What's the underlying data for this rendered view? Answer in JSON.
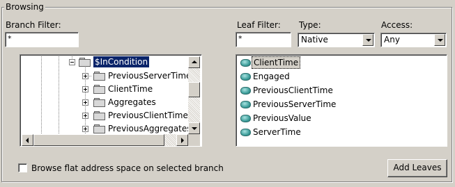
{
  "group": {
    "title": "Browsing"
  },
  "branch_filter": {
    "label": "Branch Filter:",
    "value": "*"
  },
  "leaf_filter": {
    "label": "Leaf Filter:",
    "value": "*"
  },
  "type": {
    "label": "Type:",
    "selected": "Native"
  },
  "access": {
    "label": "Access:",
    "selected": "Any"
  },
  "tree": {
    "items": [
      {
        "label": "$InCondition",
        "expanded": true,
        "selected": true
      },
      {
        "label": "PreviousServerTime"
      },
      {
        "label": "ClientTime"
      },
      {
        "label": "Aggregates"
      },
      {
        "label": "PreviousClientTime"
      },
      {
        "label": "PreviousAggregates"
      }
    ]
  },
  "leaves": {
    "items": [
      {
        "label": "ClientTime",
        "selected": true
      },
      {
        "label": "Engaged"
      },
      {
        "label": "PreviousClientTime"
      },
      {
        "label": "PreviousServerTime"
      },
      {
        "label": "PreviousValue"
      },
      {
        "label": "ServerTime"
      }
    ]
  },
  "browse_flat": {
    "label": "Browse flat address space on selected branch",
    "checked": false
  },
  "add_leaves_button": {
    "label": "Add Leaves"
  }
}
